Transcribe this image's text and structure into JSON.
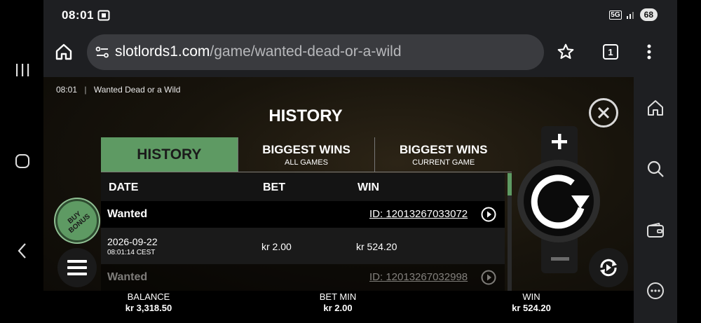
{
  "status_bar": {
    "time": "08:01",
    "network": "5G",
    "battery": "68"
  },
  "browser": {
    "url_host": "slotlords1.com",
    "url_path": "/game/wanted-dead-or-a-wild",
    "tab_count": "1"
  },
  "game": {
    "top_time": "08:01",
    "top_title": "Wanted Dead or a Wild",
    "history_title": "HISTORY",
    "tabs": [
      {
        "main": "HISTORY",
        "sub": "",
        "active": true
      },
      {
        "main": "BIGGEST WINS",
        "sub": "ALL GAMES",
        "active": false
      },
      {
        "main": "BIGGEST WINS",
        "sub": "CURRENT GAME",
        "active": false
      }
    ],
    "columns": {
      "date": "DATE",
      "bet": "BET",
      "win": "WIN"
    },
    "rows": [
      {
        "name": "Wanted",
        "id": "ID: 12013267033072",
        "date": "2026-09-22",
        "time": "08:01:14 CEST",
        "bet": "kr 2.00",
        "win": "kr 524.20"
      },
      {
        "name": "Wanted",
        "id": "ID: 12013267032998"
      }
    ],
    "buy_bonus": "BUY BONUS",
    "balance_label": "BALANCE",
    "balance_value": "kr 3,318.50",
    "bet_label": "BET MIN",
    "bet_value": "kr 2.00",
    "win_label": "WIN",
    "win_value": "kr 524.20"
  },
  "colors": {
    "accent": "#5e9a63",
    "chrome": "#1e1f22",
    "urlbox": "#3a3b3f"
  },
  "icons": [
    "menu-lines-icon",
    "home-circle-icon",
    "back-icon",
    "cast-icon",
    "home-icon",
    "site-settings-icon",
    "star-icon",
    "more-vert-icon",
    "close-icon",
    "play-circle-icon",
    "hamburger-icon",
    "plus-icon",
    "minus-icon",
    "spin-icon",
    "autoplay-icon",
    "search-icon",
    "wallet-icon",
    "more-horiz-icon"
  ]
}
